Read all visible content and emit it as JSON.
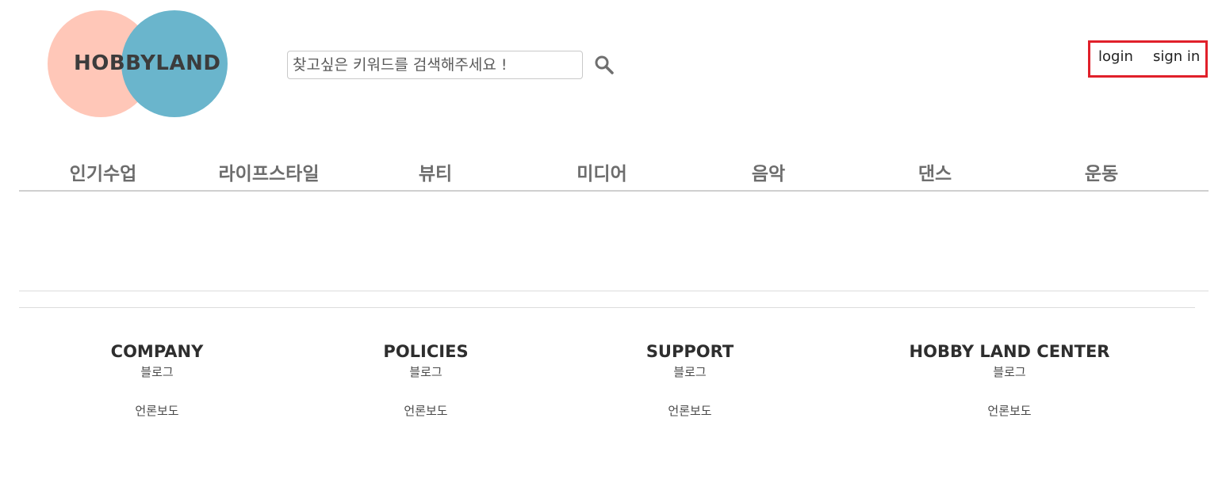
{
  "header": {
    "logo_text": "HOBBYLAND",
    "search": {
      "placeholder": "찾고싶은 키워드를 검색해주세요 !",
      "value": "",
      "icon": "search-icon"
    },
    "auth": {
      "login_label": "login",
      "signin_label": "sign in",
      "highlight_color": "#e0202a"
    }
  },
  "colors": {
    "logo_left": "#ffc7b8",
    "logo_right": "#6ab5cc"
  },
  "nav": {
    "items": [
      {
        "label": "인기수업"
      },
      {
        "label": "라이프스타일"
      },
      {
        "label": "뷰티"
      },
      {
        "label": "미디어"
      },
      {
        "label": "음악"
      },
      {
        "label": "댄스"
      },
      {
        "label": "운동"
      }
    ]
  },
  "footer": {
    "columns": [
      {
        "heading": "COMPANY",
        "links": [
          "블로그",
          "언론보도"
        ]
      },
      {
        "heading": "POLICIES",
        "links": [
          "블로그",
          "언론보도"
        ]
      },
      {
        "heading": "SUPPORT",
        "links": [
          "블로그",
          "언론보도"
        ]
      },
      {
        "heading": "HOBBY LAND CENTER",
        "links": [
          "블로그",
          "언론보도"
        ]
      }
    ]
  }
}
